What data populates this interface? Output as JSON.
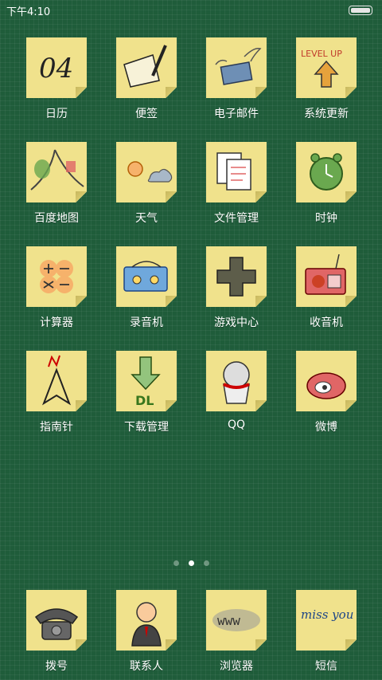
{
  "status_bar": {
    "time": "下午4:10"
  },
  "apps": [
    {
      "label": "日历",
      "icon": "calendar-icon"
    },
    {
      "label": "便签",
      "icon": "notepad-icon"
    },
    {
      "label": "电子邮件",
      "icon": "email-icon"
    },
    {
      "label": "系统更新",
      "icon": "system-update-icon"
    },
    {
      "label": "百度地图",
      "icon": "map-icon"
    },
    {
      "label": "天气",
      "icon": "weather-icon"
    },
    {
      "label": "文件管理",
      "icon": "file-manager-icon"
    },
    {
      "label": "时钟",
      "icon": "clock-icon"
    },
    {
      "label": "计算器",
      "icon": "calculator-icon"
    },
    {
      "label": "录音机",
      "icon": "recorder-icon"
    },
    {
      "label": "游戏中心",
      "icon": "game-center-icon"
    },
    {
      "label": "收音机",
      "icon": "radio-icon"
    },
    {
      "label": "指南针",
      "icon": "compass-icon"
    },
    {
      "label": "下载管理",
      "icon": "download-icon"
    },
    {
      "label": "QQ",
      "icon": "qq-icon"
    },
    {
      "label": "微博",
      "icon": "weibo-icon"
    }
  ],
  "dock": [
    {
      "label": "拨号",
      "icon": "phone-icon"
    },
    {
      "label": "联系人",
      "icon": "contacts-icon"
    },
    {
      "label": "浏览器",
      "icon": "browser-icon"
    },
    {
      "label": "短信",
      "icon": "messages-icon"
    }
  ],
  "icon_text": {
    "calendar_date": "04",
    "update_text": "LEVEL UP",
    "download_text": "DL",
    "browser_text": "www",
    "messages_text": "miss you"
  },
  "page_indicator": {
    "pages": 3,
    "current": 2
  },
  "colors": {
    "background": "#1f5c3a",
    "note": "#f0e28c"
  }
}
